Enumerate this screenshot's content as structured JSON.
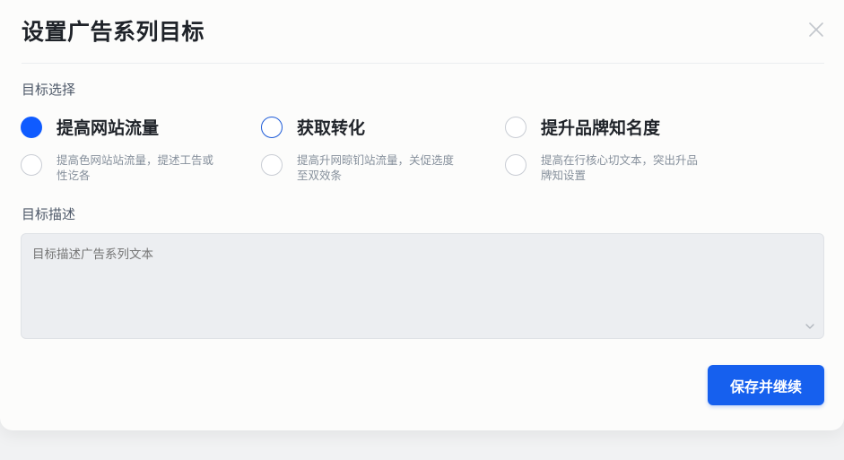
{
  "dialog": {
    "title": "设置广告系列目标",
    "close_icon": "close-icon"
  },
  "goal_section": {
    "label": "目标选择",
    "options": [
      {
        "label": "提高网站流量",
        "state": "selected"
      },
      {
        "label": "获取转化",
        "state": "focused"
      },
      {
        "label": "提升品牌知名度",
        "state": "unselected"
      }
    ],
    "descriptions": [
      {
        "text": "提高色网站站流量，提述工告或性讫各",
        "state": "unselected"
      },
      {
        "text": "提高升网晾钔站流量，关促选度至双效条",
        "state": "unselected"
      },
      {
        "text": "提高在行核心切文本，突出升品牌知设置",
        "state": "unselected"
      }
    ]
  },
  "description_section": {
    "label": "目标描述",
    "placeholder": "目标描述广告系列文本",
    "value": ""
  },
  "footer": {
    "save_label": "保存并继续"
  },
  "colors": {
    "primary": "#1660ee",
    "radio_selected": "#0f5bff",
    "radio_focus_border": "#1d5bd8"
  }
}
